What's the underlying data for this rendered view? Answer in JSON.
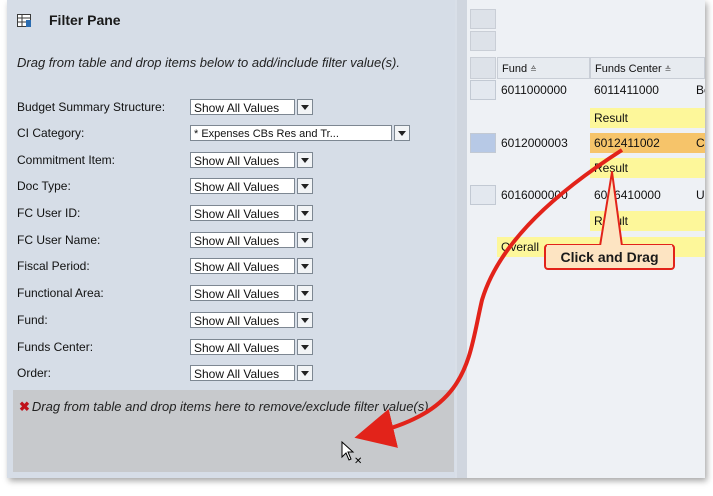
{
  "filter_pane": {
    "title": "Filter Pane",
    "instruction": "Drag from table and drop items below to add/include filter value(s).",
    "filters": [
      {
        "label": "Budget Summary Structure:",
        "value": "Show All Values",
        "wide": false
      },
      {
        "label": "CI Category:",
        "value": "* Expenses CBs Res and Tr...",
        "wide": true
      },
      {
        "label": "Commitment Item:",
        "value": "Show All Values",
        "wide": false
      },
      {
        "label": "Doc Type:",
        "value": "Show All Values",
        "wide": false
      },
      {
        "label": "FC User ID:",
        "value": "Show All Values",
        "wide": false
      },
      {
        "label": "FC User Name:",
        "value": "Show All Values",
        "wide": false
      },
      {
        "label": "Fiscal Period:",
        "value": "Show All Values",
        "wide": false
      },
      {
        "label": "Functional Area:",
        "value": "Show All Values",
        "wide": false
      },
      {
        "label": "Fund:",
        "value": "Show All Values",
        "wide": false
      },
      {
        "label": "Funds Center:",
        "value": "Show All Values",
        "wide": false
      },
      {
        "label": "Order:",
        "value": "Show All Values",
        "wide": false
      }
    ],
    "remove_instruction": "Drag from table and drop items here to remove/exclude filter value(s)."
  },
  "table": {
    "headers": [
      "Fund",
      "Funds Center"
    ],
    "rows": [
      {
        "fund": "6011000000",
        "funds_center": "6011411000",
        "extra": "Bo"
      },
      {
        "fund": "",
        "funds_center": "Result",
        "extra": ""
      },
      {
        "fund": "6012000003",
        "funds_center": "6012411002",
        "extra": "Co"
      },
      {
        "fund": "",
        "funds_center": "Result",
        "extra": ""
      },
      {
        "fund": "6016000000",
        "funds_center": "6016410000",
        "extra": "Un"
      },
      {
        "fund": "",
        "funds_center": "Result",
        "extra": ""
      },
      {
        "fund": "Overall",
        "funds_center": "",
        "extra": ""
      }
    ]
  },
  "callout": {
    "text": "Click and Drag"
  },
  "colors": {
    "result_row": "#fdf79a",
    "highlight_cell": "#f6c46a",
    "arrow": "#e2231a"
  }
}
